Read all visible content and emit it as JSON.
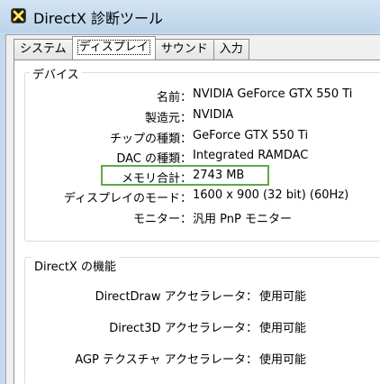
{
  "window": {
    "title": "DirectX 診断ツール",
    "icon": "directx-x-icon"
  },
  "tabs": [
    {
      "label": "システム",
      "active": false
    },
    {
      "label": "ディスプレイ",
      "active": true
    },
    {
      "label": "サウンド",
      "active": false
    },
    {
      "label": "入力",
      "active": false
    }
  ],
  "device": {
    "group_title": "デバイス",
    "rows": [
      {
        "label": "名前：",
        "value": "NVIDIA GeForce GTX 550 Ti"
      },
      {
        "label": "製造元：",
        "value": "NVIDIA"
      },
      {
        "label": "チップの種類：",
        "value": "GeForce GTX 550 Ti"
      },
      {
        "label": "DAC の種類：",
        "value": "Integrated RAMDAC"
      },
      {
        "label": "メモリ合計：",
        "value": "2743 MB"
      },
      {
        "label": "ディスプレイのモード：",
        "value": "1600 x 900 (32 bit) (60Hz)"
      },
      {
        "label": "モニター：",
        "value": "汎用 PnP モニター"
      }
    ]
  },
  "directx": {
    "group_title": "DirectX の機能",
    "rows": [
      {
        "label": "DirectDraw アクセラレータ：",
        "value": "使用可能"
      },
      {
        "label": "Direct3D アクセラレータ：",
        "value": "使用可能"
      },
      {
        "label": "AGP テクスチャ アクセラレータ：",
        "value": "使用可能"
      }
    ]
  },
  "colors": {
    "highlight_border": "#5fa84a",
    "title_bar": "#c4d9ec"
  }
}
